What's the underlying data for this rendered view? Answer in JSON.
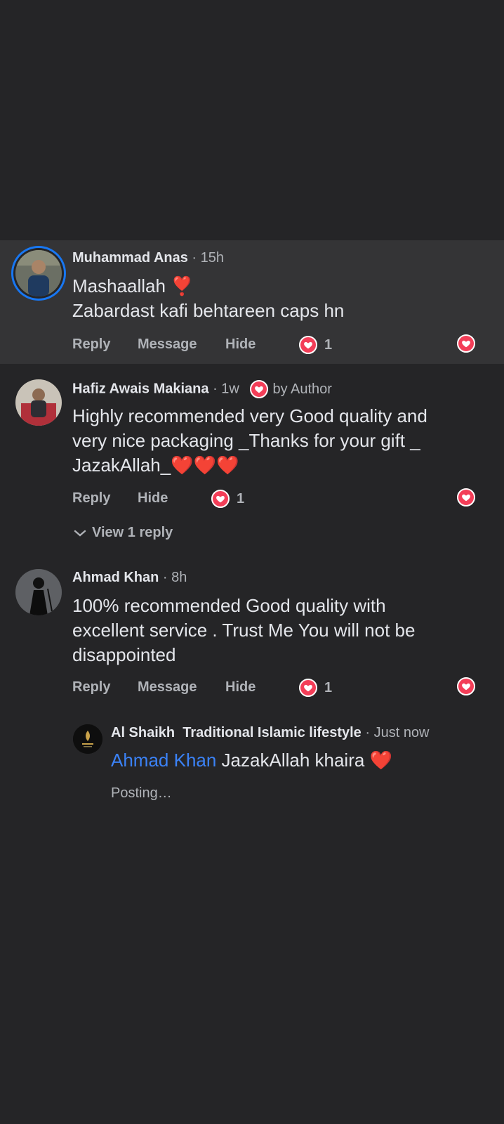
{
  "comments": [
    {
      "name": "Muhammad Anas",
      "time": "· 15h",
      "line1": "Mashaallah ",
      "line1_emoji": "❣️",
      "line2": "Zabardast kafi behtareen caps hn",
      "actions": [
        "Reply",
        "Message",
        "Hide"
      ],
      "reaction_count": "1"
    },
    {
      "name": "Hafiz Awais Makiana",
      "time": "· 1w",
      "badge": "by Author",
      "text": "Highly recommended very Good quality and very nice packaging _Thanks for your gift _ JazakAllah_",
      "text_emoji": "❤️❤️❤️",
      "actions": [
        "Reply",
        "Hide"
      ],
      "reaction_count": "1",
      "view_replies": "View 1 reply"
    },
    {
      "name": "Ahmad Khan",
      "time": "· 8h",
      "text": "100% recommended Good quality with excellent service . Trust Me You will not be disappointed",
      "actions": [
        "Reply",
        "Message",
        "Hide"
      ],
      "reaction_count": "1"
    }
  ],
  "reply": {
    "name": "Al Shaikh  Traditional Islamic lifestyle",
    "time": "· Just now",
    "mention": "Ahmad Khan",
    "text": " JazakAllah khaira ",
    "emoji": "❤️",
    "status": "Posting…"
  },
  "colors": {
    "background": "#252527",
    "highlight": "#343436",
    "reaction": "#f33e58",
    "mention": "#3b82f6",
    "avatar_ring": "#1877f2"
  }
}
